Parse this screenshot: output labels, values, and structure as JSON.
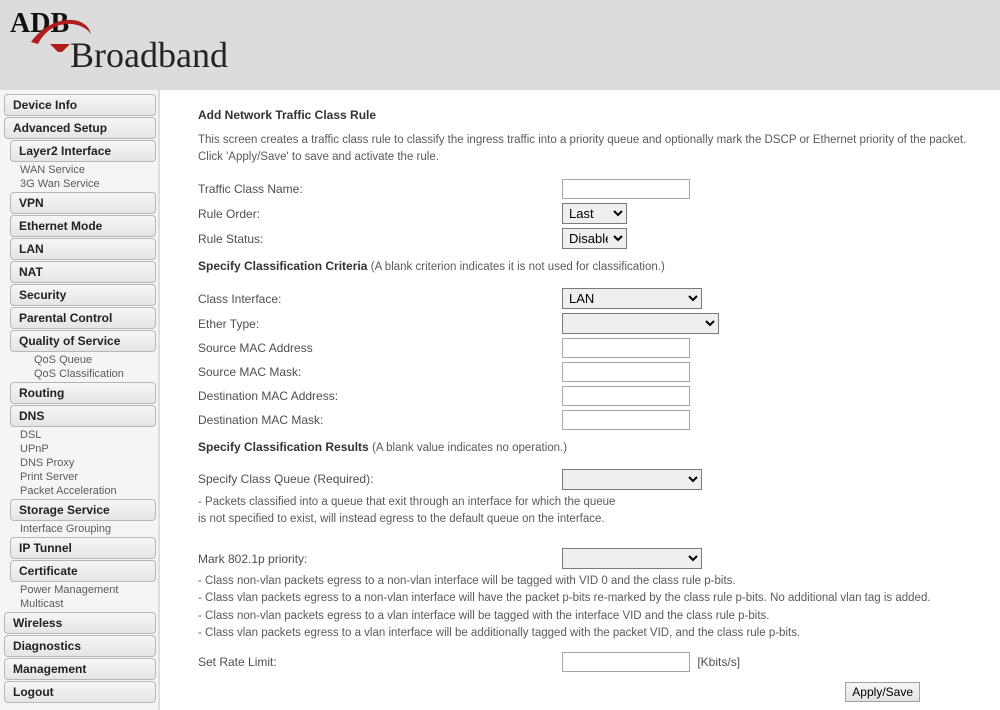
{
  "brand": {
    "adb": "ADB",
    "broadband": "Broadband"
  },
  "sidebar": {
    "device_info": "Device Info",
    "advanced_setup": "Advanced Setup",
    "layer2": "Layer2 Interface",
    "wan_service": "WAN Service",
    "wan_3g": "3G Wan Service",
    "vpn": "VPN",
    "eth_mode": "Ethernet Mode",
    "lan": "LAN",
    "nat": "NAT",
    "security": "Security",
    "parental": "Parental Control",
    "qos": "Quality of Service",
    "qos_queue": "QoS Queue",
    "qos_class": "QoS Classification",
    "routing": "Routing",
    "dns": "DNS",
    "dsl": "DSL",
    "upnp": "UPnP",
    "dns_proxy": "DNS Proxy",
    "print_server": "Print Server",
    "pkt_accel": "Packet Acceleration",
    "storage": "Storage Service",
    "if_group": "Interface Grouping",
    "ip_tunnel": "IP Tunnel",
    "certificate": "Certificate",
    "power": "Power Management",
    "multicast": "Multicast",
    "wireless": "Wireless",
    "diagnostics": "Diagnostics",
    "management": "Management",
    "logout": "Logout"
  },
  "page": {
    "title": "Add Network Traffic Class Rule",
    "intro": "This screen creates a traffic class rule to classify the ingress traffic into a priority queue and optionally mark the DSCP or Ethernet priority of the packet. Click 'Apply/Save' to save and activate the rule.",
    "labels": {
      "traffic_class_name": "Traffic Class Name:",
      "rule_order": "Rule Order:",
      "rule_status": "Rule Status:",
      "class_interface": "Class Interface:",
      "ether_type": "Ether Type:",
      "src_mac": "Source MAC Address",
      "src_mac_mask": "Source MAC Mask:",
      "dst_mac": "Destination MAC Address:",
      "dst_mac_mask": "Destination MAC Mask:",
      "spec_queue": "Specify Class Queue (Required):",
      "mark_8021p": "Mark 802.1p priority:",
      "set_rate": "Set Rate Limit:"
    },
    "sections": {
      "criteria_head": "Specify Classification Criteria",
      "criteria_help": "(A blank criterion indicates it is not used for classification.)",
      "results_head": "Specify Classification Results",
      "results_help": "(A blank value indicates no operation.)"
    },
    "values": {
      "rule_order": "Last",
      "rule_status": "Disable",
      "class_interface": "LAN",
      "traffic_class_name": "",
      "ether_type": "",
      "src_mac": "",
      "src_mac_mask": "",
      "dst_mac": "",
      "dst_mac_mask": "",
      "spec_queue": "",
      "mark_8021p": "",
      "set_rate": ""
    },
    "queue_note1": "- Packets classified into a queue that exit through an interface for which the queue",
    "queue_note2": "is not specified to exist, will instead egress to the default queue on the interface.",
    "p_notes": [
      "- Class non-vlan packets egress to a non-vlan interface will be tagged with VID 0 and the class rule p-bits.",
      "- Class vlan packets egress to a non-vlan interface will have the packet p-bits re-marked by the class rule p-bits. No additional vlan tag is added.",
      "- Class non-vlan packets egress to a vlan interface will be tagged with the interface VID and the class rule p-bits.",
      "- Class vlan packets egress to a vlan interface will be additionally tagged with the packet VID, and the class rule p-bits."
    ],
    "rate_unit": "[Kbits/s]",
    "apply": "Apply/Save"
  }
}
